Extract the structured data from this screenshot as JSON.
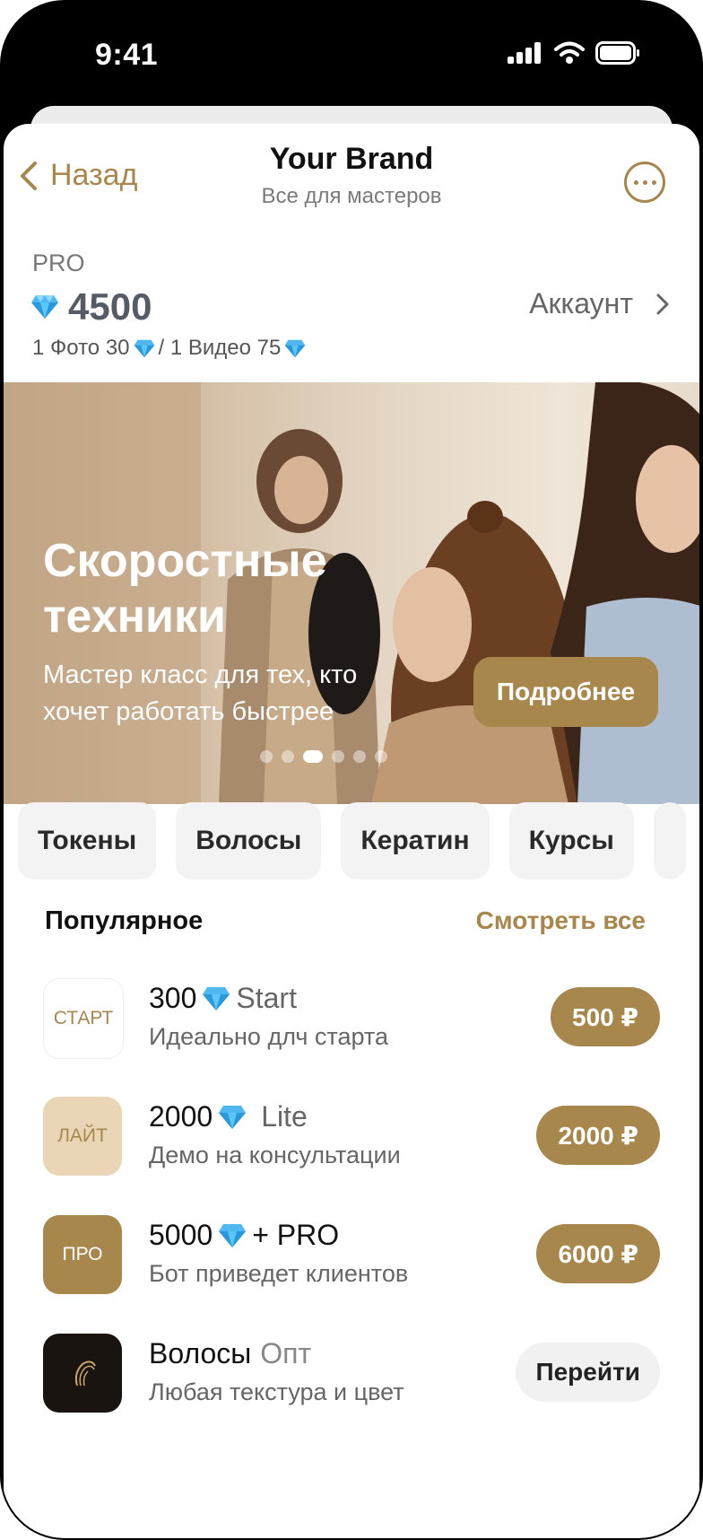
{
  "status": {
    "time": "9:41"
  },
  "header": {
    "back_label": "Назад",
    "title": "Your Brand",
    "subtitle": "Все для мастеров"
  },
  "account": {
    "plan": "PRO",
    "balance": "4500",
    "rate_photo": "1 Фото 30",
    "rate_video": "/ 1 Видео 75",
    "account_link": "Аккаунт"
  },
  "banner": {
    "title": "Скоростные техники",
    "subtitle": "Мастер класс для тех, кто хочет работать быстрее",
    "button": "Подробнее",
    "slides_total": 6,
    "active_slide": 3
  },
  "categories": [
    "Токены",
    "Волосы",
    "Кератин",
    "Курсы"
  ],
  "popular": {
    "title": "Популярное",
    "see_all": "Смотреть все",
    "items": [
      {
        "thumb": "СТАРТ",
        "amount": "300",
        "name": "Start",
        "desc": "Идеально длч старта",
        "price": "500 ₽"
      },
      {
        "thumb": "ЛАЙТ",
        "amount": "2000",
        "name": "Lite",
        "desc": "Демо на консультации",
        "price": "2000 ₽"
      },
      {
        "thumb": "ПРО",
        "amount": "5000",
        "name": "+ PRO",
        "desc": "Бот приведет клиентов",
        "price": "6000 ₽"
      },
      {
        "name": "Волосы",
        "name_suffix": "Опт",
        "desc": "Любая текстура и цвет",
        "action": "Перейти"
      }
    ]
  },
  "colors": {
    "accent": "#a8874d",
    "light_tan": "#ead5b6"
  }
}
